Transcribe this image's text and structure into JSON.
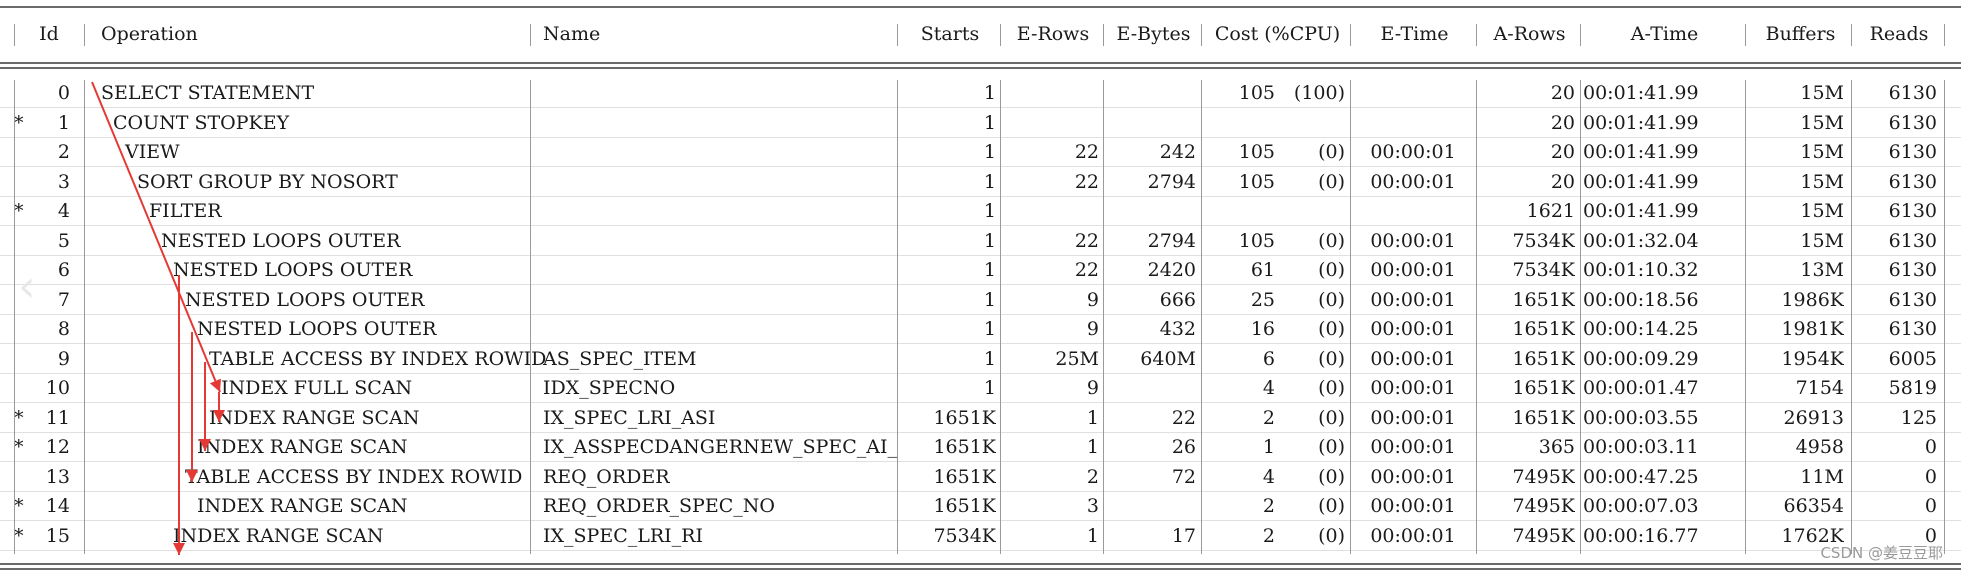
{
  "header": [
    "Id",
    "Operation",
    "Name",
    "Starts",
    "E-Rows",
    "E-Bytes",
    "Cost (%CPU)",
    "E-Time",
    "A-Rows",
    "A-Time",
    "Buffers",
    "Reads"
  ],
  "rows": [
    {
      "star": "",
      "id": "0",
      "op": "SELECT STATEMENT",
      "indent": 0,
      "name": "",
      "starts": "1",
      "erows": "",
      "ebytes": "",
      "cost": "105",
      "cpu": "(100)",
      "etime": "",
      "arows": "20",
      "atime": "00:01:41.99",
      "buffers": "15M",
      "reads": "6130"
    },
    {
      "star": "*",
      "id": "1",
      "op": "COUNT STOPKEY",
      "indent": 1,
      "name": "",
      "starts": "1",
      "erows": "",
      "ebytes": "",
      "cost": "",
      "cpu": "",
      "etime": "",
      "arows": "20",
      "atime": "00:01:41.99",
      "buffers": "15M",
      "reads": "6130"
    },
    {
      "star": "",
      "id": "2",
      "op": "VIEW",
      "indent": 2,
      "name": "",
      "starts": "1",
      "erows": "22",
      "ebytes": "242",
      "cost": "105",
      "cpu": "(0)",
      "etime": "00:00:01",
      "arows": "20",
      "atime": "00:01:41.99",
      "buffers": "15M",
      "reads": "6130"
    },
    {
      "star": "",
      "id": "3",
      "op": "SORT GROUP BY NOSORT",
      "indent": 3,
      "name": "",
      "starts": "1",
      "erows": "22",
      "ebytes": "2794",
      "cost": "105",
      "cpu": "(0)",
      "etime": "00:00:01",
      "arows": "20",
      "atime": "00:01:41.99",
      "buffers": "15M",
      "reads": "6130"
    },
    {
      "star": "*",
      "id": "4",
      "op": "FILTER",
      "indent": 4,
      "name": "",
      "starts": "1",
      "erows": "",
      "ebytes": "",
      "cost": "",
      "cpu": "",
      "etime": "",
      "arows": "1621",
      "atime": "00:01:41.99",
      "buffers": "15M",
      "reads": "6130"
    },
    {
      "star": "",
      "id": "5",
      "op": "NESTED LOOPS OUTER",
      "indent": 5,
      "name": "",
      "starts": "1",
      "erows": "22",
      "ebytes": "2794",
      "cost": "105",
      "cpu": "(0)",
      "etime": "00:00:01",
      "arows": "7534K",
      "atime": "00:01:32.04",
      "buffers": "15M",
      "reads": "6130"
    },
    {
      "star": "",
      "id": "6",
      "op": "NESTED LOOPS OUTER",
      "indent": 6,
      "name": "",
      "starts": "1",
      "erows": "22",
      "ebytes": "2420",
      "cost": "61",
      "cpu": "(0)",
      "etime": "00:00:01",
      "arows": "7534K",
      "atime": "00:01:10.32",
      "buffers": "13M",
      "reads": "6130"
    },
    {
      "star": "",
      "id": "7",
      "op": "NESTED LOOPS OUTER",
      "indent": 7,
      "name": "",
      "starts": "1",
      "erows": "9",
      "ebytes": "666",
      "cost": "25",
      "cpu": "(0)",
      "etime": "00:00:01",
      "arows": "1651K",
      "atime": "00:00:18.56",
      "buffers": "1986K",
      "reads": "6130"
    },
    {
      "star": "",
      "id": "8",
      "op": "NESTED LOOPS OUTER",
      "indent": 8,
      "name": "",
      "starts": "1",
      "erows": "9",
      "ebytes": "432",
      "cost": "16",
      "cpu": "(0)",
      "etime": "00:00:01",
      "arows": "1651K",
      "atime": "00:00:14.25",
      "buffers": "1981K",
      "reads": "6130"
    },
    {
      "star": "",
      "id": "9",
      "op": "TABLE ACCESS BY INDEX ROWID",
      "indent": 9,
      "name": "AS_SPEC_ITEM",
      "starts": "1",
      "erows": "25M",
      "ebytes": "640M",
      "cost": "6",
      "cpu": "(0)",
      "etime": "00:00:01",
      "arows": "1651K",
      "atime": "00:00:09.29",
      "buffers": "1954K",
      "reads": "6005"
    },
    {
      "star": "",
      "id": "10",
      "op": "INDEX FULL SCAN",
      "indent": 10,
      "name": "IDX_SPECNO",
      "starts": "1",
      "erows": "9",
      "ebytes": "",
      "cost": "4",
      "cpu": "(0)",
      "etime": "00:00:01",
      "arows": "1651K",
      "atime": "00:00:01.47",
      "buffers": "7154",
      "reads": "5819"
    },
    {
      "star": "*",
      "id": "11",
      "op": "INDEX RANGE SCAN",
      "indent": 9,
      "name": "IX_SPEC_LRI_ASI",
      "starts": "1651K",
      "erows": "1",
      "ebytes": "22",
      "cost": "2",
      "cpu": "(0)",
      "etime": "00:00:01",
      "arows": "1651K",
      "atime": "00:00:03.55",
      "buffers": "26913",
      "reads": "125"
    },
    {
      "star": "*",
      "id": "12",
      "op": "INDEX RANGE SCAN",
      "indent": 8,
      "name": "IX_ASSPECDANGERNEW_SPEC_AI_OP",
      "starts": "1651K",
      "erows": "1",
      "ebytes": "26",
      "cost": "1",
      "cpu": "(0)",
      "etime": "00:00:01",
      "arows": "365",
      "atime": "00:00:03.11",
      "buffers": "4958",
      "reads": "0"
    },
    {
      "star": "",
      "id": "13",
      "op": "TABLE ACCESS BY INDEX ROWID",
      "indent": 7,
      "name": "REQ_ORDER",
      "starts": "1651K",
      "erows": "2",
      "ebytes": "72",
      "cost": "4",
      "cpu": "(0)",
      "etime": "00:00:01",
      "arows": "7495K",
      "atime": "00:00:47.25",
      "buffers": "11M",
      "reads": "0"
    },
    {
      "star": "*",
      "id": "14",
      "op": "INDEX RANGE SCAN",
      "indent": 8,
      "name": "REQ_ORDER_SPEC_NO",
      "starts": "1651K",
      "erows": "3",
      "ebytes": "",
      "cost": "2",
      "cpu": "(0)",
      "etime": "00:00:01",
      "arows": "7495K",
      "atime": "00:00:07.03",
      "buffers": "66354",
      "reads": "0"
    },
    {
      "star": "*",
      "id": "15",
      "op": "INDEX RANGE SCAN",
      "indent": 6,
      "name": "IX_SPEC_LRI_RI",
      "starts": "7534K",
      "erows": "1",
      "ebytes": "17",
      "cost": "2",
      "cpu": "(0)",
      "etime": "00:00:01",
      "arows": "7495K",
      "atime": "00:00:16.77",
      "buffers": "1762K",
      "reads": "0"
    }
  ],
  "watermark": "CSDN @姜豆豆耶",
  "colors": {
    "arrow": "#e53935",
    "text": "#1a1a1a",
    "rule": "#6a6a6a",
    "separator": "#9a9a9a"
  },
  "icons": {
    "nav": "chevron-left-icon"
  }
}
